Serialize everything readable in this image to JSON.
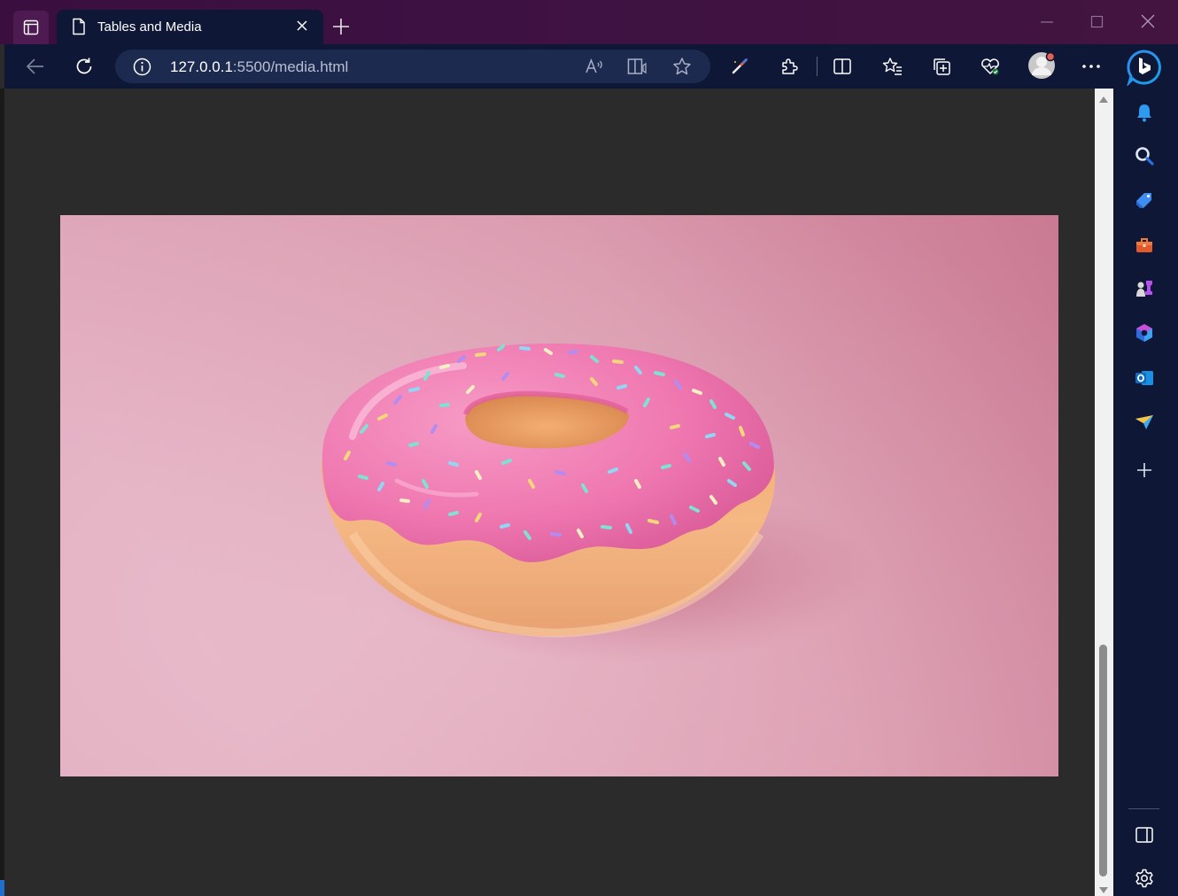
{
  "window": {
    "tab_title": "Tables and Media",
    "url_host": "127.0.0.1",
    "url_path": ":5500/media.html"
  },
  "icons": {
    "titlebar": [
      "tab-actions-icon",
      "document-icon",
      "close-icon",
      "plus-icon",
      "minimize-icon",
      "maximize-icon",
      "close-window-icon"
    ],
    "toolbar": [
      "back-arrow-icon",
      "refresh-icon",
      "info-icon",
      "read-aloud-icon",
      "immersive-reader-icon",
      "favorite-star-icon",
      "browser-essentials-icon",
      "extensions-icon",
      "split-screen-icon",
      "favorites-icon",
      "collections-icon",
      "health-icon",
      "profile-avatar-icon",
      "more-icon",
      "bing-copilot-icon"
    ],
    "sidebar": [
      "bell-icon",
      "search-icon",
      "shopping-tag-icon",
      "tools-icon",
      "games-icon",
      "microsoft-365-icon",
      "outlook-icon",
      "drop-icon",
      "add-icon",
      "hide-sidebar-icon",
      "settings-icon"
    ]
  },
  "page": {
    "image_subject": "pink frosted donut with sprinkles on pink background"
  },
  "colors": {
    "titlebar": "#3d1142",
    "toolbar": "#0f1736",
    "page_background": "#2b2b2b",
    "image_background": "#e3aabb",
    "frosting": "#ef73ad"
  }
}
